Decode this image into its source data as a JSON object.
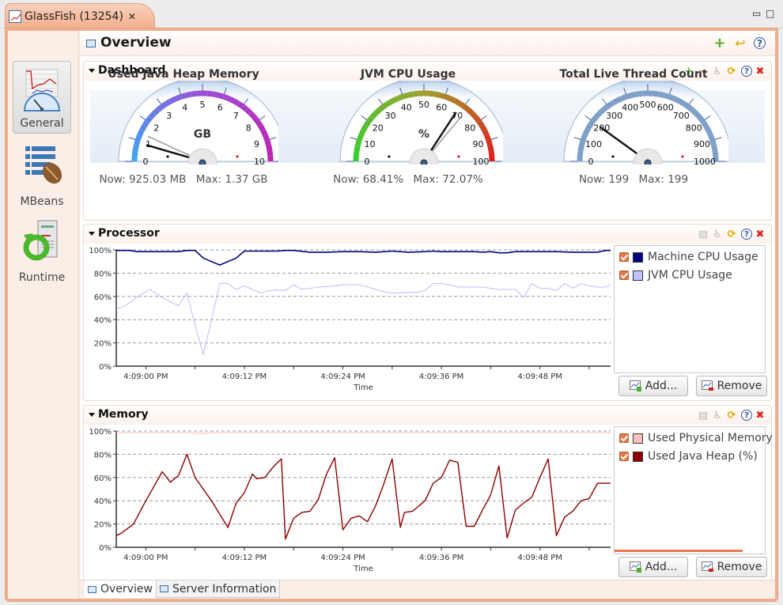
{
  "window": {
    "tab_title": "GlassFish (13254)",
    "tab_close": "✕",
    "minimize": "▭",
    "maximize": "□"
  },
  "sidebar": {
    "items": [
      {
        "label": "General",
        "icon": "general-chart-gauge-icon",
        "active": true
      },
      {
        "label": "MBeans",
        "icon": "mbeans-list-bean-icon",
        "active": false
      },
      {
        "label": "Runtime",
        "icon": "runtime-server-icon",
        "active": false
      }
    ]
  },
  "overview": {
    "title": "Overview",
    "actions": [
      {
        "name": "add-icon",
        "glyph": "+"
      },
      {
        "name": "back-arrow-icon",
        "glyph": "↩"
      },
      {
        "name": "help-icon",
        "glyph": "?"
      }
    ]
  },
  "dashboard": {
    "title": "Dashboard",
    "tools": [
      {
        "name": "add-icon",
        "glyph": "+",
        "color": "#4caf2a"
      },
      {
        "name": "remove-icon",
        "glyph": "−",
        "color": "#c49a4a"
      },
      {
        "name": "accessibility-icon",
        "glyph": "♿",
        "color": "#b9b9b9"
      },
      {
        "name": "refresh-icon",
        "glyph": "⟳",
        "color": "#e0a800"
      },
      {
        "name": "help-icon",
        "glyph": "?",
        "color": "#2a5db0"
      },
      {
        "name": "close-icon",
        "glyph": "✖",
        "color": "#e02020"
      }
    ],
    "gauges": [
      {
        "title": "Used Java Heap Memory",
        "unit": "GB",
        "min": 0,
        "max": 10,
        "ticks": [
          "0",
          "1",
          "2",
          "3",
          "4",
          "5",
          "6",
          "7",
          "8",
          "9",
          "10"
        ],
        "value": 0.903,
        "peak": 1.37,
        "arc_colors": [
          "#3aa7f5",
          "#9a4fd6",
          "#c020b0"
        ],
        "now_label": "Now: 925.03 MB",
        "max_label": "Max: 1.37 GB"
      },
      {
        "title": "JVM CPU Usage",
        "unit": "%",
        "min": 0,
        "max": 100,
        "ticks": [
          "0",
          "10",
          "20",
          "30",
          "40",
          "50",
          "60",
          "70",
          "80",
          "90",
          "100"
        ],
        "value": 68.41,
        "peak": 72.07,
        "arc_colors": [
          "#2fd02f",
          "#a0a030",
          "#e01a1a"
        ],
        "now_label": "Now: 68.41%",
        "max_label": "Max: 72.07%"
      },
      {
        "title": "Total Live Thread Count",
        "unit": "",
        "min": 0,
        "max": 1000,
        "ticks": [
          "0",
          "100",
          "200",
          "300",
          "400",
          "500",
          "600",
          "700",
          "800",
          "900",
          "1000"
        ],
        "value": 199,
        "peak": 199,
        "arc_colors": [
          "#7f9fc8",
          "#7f9fc8",
          "#7f9fc8"
        ],
        "now_label": "Now: 199",
        "max_label": "Max: 199"
      }
    ]
  },
  "processor": {
    "title": "Processor",
    "tools": [
      {
        "name": "chart-settings-icon",
        "glyph": "▤",
        "color": "#b9b9b9"
      },
      {
        "name": "accessibility-icon",
        "glyph": "♿",
        "color": "#b9b9b9"
      },
      {
        "name": "refresh-icon",
        "glyph": "⟳",
        "color": "#e0a800"
      },
      {
        "name": "help-icon",
        "glyph": "?",
        "color": "#2a5db0"
      },
      {
        "name": "close-icon",
        "glyph": "✖",
        "color": "#e02020"
      }
    ],
    "legend": [
      {
        "label": "Machine CPU Usage",
        "color": "#000080",
        "checked": true
      },
      {
        "label": "JVM CPU Usage",
        "color": "#c0c0ff",
        "checked": true
      }
    ],
    "add_label": "Add...",
    "remove_label": "Remove"
  },
  "memory": {
    "title": "Memory",
    "tools": [
      {
        "name": "chart-settings-icon",
        "glyph": "▤",
        "color": "#b9b9b9"
      },
      {
        "name": "accessibility-icon",
        "glyph": "♿",
        "color": "#b9b9b9"
      },
      {
        "name": "refresh-icon",
        "glyph": "⟳",
        "color": "#e0a800"
      },
      {
        "name": "help-icon",
        "glyph": "?",
        "color": "#2a5db0"
      },
      {
        "name": "close-icon",
        "glyph": "✖",
        "color": "#e02020"
      }
    ],
    "legend": [
      {
        "label": "Used Physical Memory",
        "color": "#ffc0c0",
        "checked": true
      },
      {
        "label": "Used Java Heap (%)",
        "color": "#8b0000",
        "checked": true
      }
    ],
    "add_label": "Add...",
    "remove_label": "Remove"
  },
  "bottom_tabs": [
    {
      "label": "Overview",
      "active": true
    },
    {
      "label": "Server Information",
      "active": false
    }
  ],
  "chart_data": [
    {
      "type": "line",
      "title": "Processor",
      "xlabel": "Time",
      "ylabel": "",
      "ylim": [
        0,
        100
      ],
      "yticks": [
        "0%",
        "20%",
        "40%",
        "60%",
        "80%",
        "100%"
      ],
      "xticks": [
        {
          "t": 0,
          "label": "4:09:00 PM"
        },
        {
          "t": 12,
          "label": "4:09:12 PM"
        },
        {
          "t": 24,
          "label": "4:09:24 PM"
        },
        {
          "t": 36,
          "label": "4:09:36 PM"
        },
        {
          "t": 48,
          "label": "4:09:48 PM"
        }
      ],
      "minor_xticks": [
        6,
        18,
        30,
        42,
        54
      ],
      "xlim_seconds_from_4_09_00": [
        -3.6,
        56.6
      ],
      "grid": true,
      "series": [
        {
          "name": "Machine CPU Usage",
          "color": "#000080",
          "x": [
            -3.6,
            -2,
            -1,
            2,
            4,
            5,
            6,
            7,
            9,
            11,
            12,
            13,
            14,
            16,
            17,
            18,
            20,
            22,
            24,
            25,
            26,
            28,
            30,
            32,
            34,
            35,
            36,
            38,
            40,
            41,
            42,
            43,
            44,
            45,
            46,
            48,
            50,
            52,
            53,
            54,
            55,
            56,
            56.6
          ],
          "y": [
            99.5,
            99.5,
            98.5,
            98.5,
            98.5,
            99.5,
            99.5,
            93,
            87,
            93,
            99,
            99,
            99,
            99,
            99.5,
            99.5,
            98,
            98,
            98.5,
            98.5,
            98.5,
            98,
            99,
            98,
            98.5,
            99,
            98.5,
            98.5,
            98.5,
            98,
            98.5,
            97.5,
            97.5,
            98.5,
            98.5,
            98.5,
            98.5,
            98,
            98,
            98,
            98,
            99.5,
            99.5
          ]
        },
        {
          "name": "JVM CPU Usage",
          "color": "#c0c0ff",
          "x": [
            -3.6,
            -2.5,
            -1,
            0.5,
            2,
            4,
            5,
            6,
            7,
            8,
            9,
            10,
            11,
            12,
            13,
            14,
            15,
            16,
            17,
            18,
            19,
            20,
            21,
            22,
            23,
            24,
            25,
            26,
            27,
            28,
            29,
            30,
            31,
            32,
            33,
            34,
            35,
            36,
            37,
            38,
            39,
            40,
            41,
            42,
            43,
            44,
            45,
            46,
            47,
            48,
            49,
            50,
            51,
            52,
            53,
            54,
            55,
            56,
            56.6
          ],
          "y": [
            49,
            52,
            60,
            66,
            59,
            52,
            63,
            35,
            10,
            40,
            71,
            71,
            66,
            69,
            66,
            63,
            65,
            65.5,
            65,
            70,
            66,
            67,
            68,
            68.5,
            69,
            70,
            70,
            70,
            68,
            66,
            64,
            63,
            63,
            63.5,
            63.5,
            65,
            71,
            71,
            70,
            68,
            68,
            68,
            68,
            67,
            66,
            66,
            66,
            59,
            71,
            67,
            67,
            65,
            71,
            67,
            71,
            69,
            68,
            68,
            70,
            68,
            66,
            68,
            69,
            70,
            70,
            68,
            70,
            67,
            66,
            68
          ]
        }
      ]
    },
    {
      "type": "line",
      "title": "Memory",
      "xlabel": "Time",
      "ylabel": "",
      "ylim": [
        0,
        100
      ],
      "yticks": [
        "0%",
        "20%",
        "40%",
        "60%",
        "80%",
        "100%"
      ],
      "xticks": [
        {
          "t": 0,
          "label": "4:09:00 PM"
        },
        {
          "t": 12,
          "label": "4:09:12 PM"
        },
        {
          "t": 24,
          "label": "4:09:24 PM"
        },
        {
          "t": 36,
          "label": "4:09:36 PM"
        },
        {
          "t": 48,
          "label": "4:09:48 PM"
        }
      ],
      "minor_xticks": [
        6,
        18,
        30,
        42,
        54
      ],
      "xlim_seconds_from_4_09_00": [
        -3.6,
        56.6
      ],
      "grid": true,
      "series": [
        {
          "name": "Used Physical Memory",
          "color": "#ffc0c0",
          "x": [
            -3.6,
            6,
            7,
            8,
            56.6
          ],
          "y": [
            98.5,
            98.5,
            98,
            98.5,
            98.5
          ]
        },
        {
          "name": "Used Java Heap (%)",
          "color": "#8b0000",
          "x": [
            -3.6,
            -3,
            -1.5,
            0,
            2,
            3,
            4,
            5,
            6,
            8,
            10,
            11,
            12,
            13,
            13.5,
            14.5,
            15.5,
            16.5,
            17,
            18,
            19,
            20,
            21,
            22,
            23,
            24,
            25,
            26,
            27,
            28,
            29,
            30,
            31,
            31.5,
            32.5,
            34,
            35,
            36,
            37,
            38,
            39,
            40,
            41,
            42,
            43,
            44,
            45,
            46,
            47,
            48,
            49,
            50,
            51,
            52,
            53,
            54,
            55,
            56.6
          ],
          "y": [
            10,
            12,
            20,
            40,
            65,
            56,
            62,
            80,
            60,
            40,
            17,
            38,
            47,
            63,
            59,
            60,
            69,
            76,
            7,
            25,
            30,
            31,
            41,
            63,
            77,
            15,
            25,
            27,
            22,
            36,
            55,
            76,
            17,
            30,
            31,
            40,
            55,
            60,
            75,
            73,
            18,
            18,
            32,
            45,
            70,
            8,
            32,
            38,
            43,
            60,
            76,
            10,
            26,
            31,
            40,
            42,
            55,
            55
          ]
        }
      ]
    }
  ]
}
